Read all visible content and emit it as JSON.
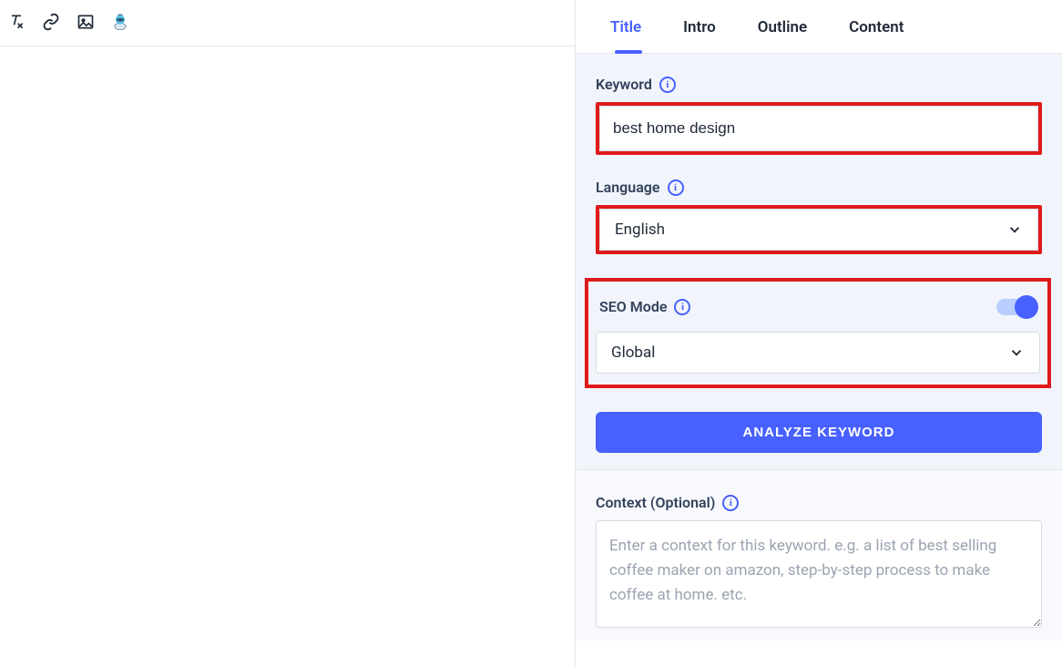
{
  "toolbar": {
    "icons": [
      "clear-format-icon",
      "link-icon",
      "image-icon",
      "robot-icon"
    ]
  },
  "tabs": [
    {
      "label": "Title",
      "active": true
    },
    {
      "label": "Intro",
      "active": false
    },
    {
      "label": "Outline",
      "active": false
    },
    {
      "label": "Content",
      "active": false
    }
  ],
  "keyword": {
    "label": "Keyword",
    "value": "best home design"
  },
  "language": {
    "label": "Language",
    "value": "English"
  },
  "seo": {
    "label": "SEO Mode",
    "region": "Global",
    "enabled": true
  },
  "analyze_label": "ANALYZE KEYWORD",
  "context": {
    "label": "Context (Optional)",
    "placeholder": "Enter a context for this keyword. e.g. a list of best selling coffee maker on amazon, step-by-step process to make coffee at home. etc.",
    "value": ""
  },
  "colors": {
    "accent": "#4760ff",
    "annotation": "#de1a1a",
    "panel_bg": "#f1f5fb"
  }
}
